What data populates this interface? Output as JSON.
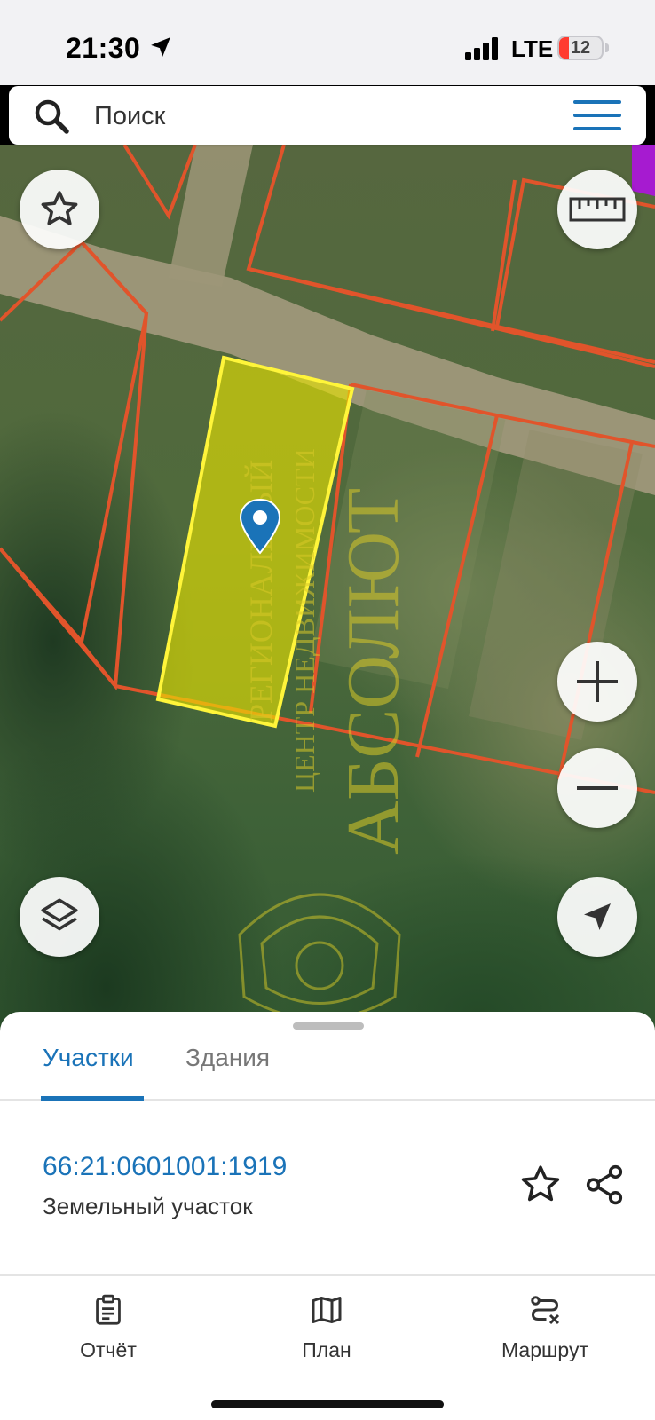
{
  "status_bar": {
    "time": "21:30",
    "network": "LTE",
    "battery": "12"
  },
  "search": {
    "placeholder": "Поиск"
  },
  "map": {
    "watermark_lines": [
      "РЕГИОНАЛЬНЫЙ",
      "ЦЕНТР НЕДВИЖИМОСТИ",
      "АБСОЛЮТ"
    ],
    "colors": {
      "parcel_border": "#e1542b",
      "selected_fill": "#e8e400",
      "selected_border": "#fff53a",
      "marker": "#1a73b8"
    }
  },
  "sheet": {
    "tabs": [
      {
        "label": "Участки",
        "active": true
      },
      {
        "label": "Здания",
        "active": false
      }
    ],
    "parcel": {
      "number": "66:21:0601001:1919",
      "type": "Земельный участок"
    }
  },
  "nav": [
    {
      "label": "Отчёт",
      "icon": "clipboard-icon"
    },
    {
      "label": "План",
      "icon": "map-icon"
    },
    {
      "label": "Маршрут",
      "icon": "route-icon"
    }
  ],
  "accent_color": "#1a73b8"
}
